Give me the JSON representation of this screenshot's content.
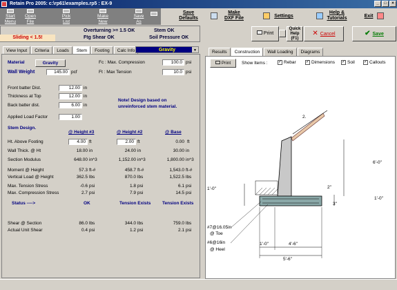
{
  "window": {
    "title": "Retain Pro 2005: c:\\rp61\\examples.rp5 : EX-9",
    "min": "_",
    "max": "□",
    "close": "×"
  },
  "toolbar1": [
    {
      "l1": "Start",
      "l2": "Menu"
    },
    {
      "l1": "Open",
      "l2": "File"
    },
    {
      "l1": "Pick",
      "l2": "List"
    },
    {
      "l1": "Make",
      "l2": "New"
    },
    {
      "l1": "Save",
      "l2": "As"
    },
    {
      "l1": "Print",
      "l2": ""
    }
  ],
  "toolbar2": {
    "save_defaults": [
      "Save",
      "Defaults"
    ],
    "make_dxf": [
      "Make",
      "DXF File"
    ],
    "settings": "Settings",
    "help": [
      "Help &",
      "Tutorials"
    ],
    "exit": "Exit"
  },
  "status": {
    "overturning": "Overturning >= 1.5 OK",
    "stem": "Stem OK",
    "sliding": "Sliding < 1.5!",
    "ftg_shear": "Ftg Shear OK",
    "soil_pressure": "Soil Pressure OK"
  },
  "actions": {
    "print": "Print",
    "quick_help": [
      "Quick",
      "Help",
      "(F1)"
    ],
    "cancel": "Cancel",
    "save": "Save"
  },
  "left_tabs": [
    "View Input",
    "Criteria",
    "Loads",
    "Stem",
    "Footing",
    "Calc Info"
  ],
  "material_select": "Gravity",
  "inputs": {
    "material_label": "Material",
    "material_btn": "Gravity",
    "wall_weight_label": "Wall Weight",
    "wall_weight": "145.00",
    "wall_weight_unit": "pcf",
    "fc_label": "Fc : Max. Compression",
    "fc": "100.0",
    "fc_unit": "psi",
    "ft_label": "Ft : Max Tension",
    "ft": "10.0",
    "ft_unit": "psi",
    "front_batter_label": "Front batter Dist.",
    "front_batter": "12.00",
    "thickness_label": "Thickness at Top",
    "thickness": "12.00",
    "back_batter_label": "Back batter dist.",
    "back_batter": "6.00",
    "unit_in": "in",
    "load_factor_label": "Applied Load Factor",
    "load_factor": "1.00",
    "note": "Note! Design based on unreinforced stem material."
  },
  "stem_design": {
    "title": "Stem Design.",
    "headers": [
      "@ Height #3",
      "@ Height #2",
      "@ Base"
    ],
    "ht_label": "Ht. Above Footing",
    "ht": [
      "4.00",
      "2.00",
      "0.00"
    ],
    "ht_unit": "ft",
    "rows": [
      {
        "label": "Wall Thick. @ Ht",
        "vals": [
          "18.00",
          "24.00",
          "30.00"
        ],
        "unit": "in"
      },
      {
        "label": "Section Modulus",
        "vals": [
          "648.00",
          "1,152.00",
          "1,800.00"
        ],
        "unit": "in^3"
      },
      {
        "label": "Moment @ Height",
        "vals": [
          "57.3",
          "458.7",
          "1,543.0"
        ],
        "unit": "ft-#"
      },
      {
        "label": "Vertical Load @ Height",
        "vals": [
          "362.5",
          "870.0",
          "1,522.5"
        ],
        "unit": "lbs"
      },
      {
        "label": "Max. Tension Stress",
        "vals": [
          "-0.6",
          "1.8",
          "6.1"
        ],
        "unit": "psi"
      },
      {
        "label": "Max. Compression Stress",
        "vals": [
          "2.7",
          "7.9",
          "14.5"
        ],
        "unit": "psi"
      }
    ],
    "status_label": "Status ---->",
    "status_vals": [
      "OK",
      "Tension Exists",
      "Tension Exists"
    ],
    "rows2": [
      {
        "label": "Shear @ Section",
        "vals": [
          "86.0",
          "344.0",
          "759.0"
        ],
        "unit": "lbs"
      },
      {
        "label": "Actual Unit Shear",
        "vals": [
          "0.4",
          "1.2",
          "2.1"
        ],
        "unit": "psi"
      }
    ]
  },
  "right_tabs": [
    "Results",
    "Construction",
    "Wall Loading",
    "Diagrams"
  ],
  "right_print": "Print",
  "show_items_label": "Show Items :",
  "show_items": [
    {
      "label": "Rebar",
      "checked": "✓"
    },
    {
      "label": "Dimensions",
      "checked": "✓"
    },
    {
      "label": "Soil",
      "checked": "✓"
    },
    {
      "label": "Callouts",
      "checked": "✓"
    }
  ],
  "drawing": {
    "dims": {
      "top": "2.",
      "right_height": "6'-0\"",
      "left_1": "1'-0\"",
      "right_2in": "2\"",
      "right_1ft": "1'-0\"",
      "right_3in": "3\"",
      "bot_1": "1'-0\"",
      "bot_2": "4'-6\"",
      "bot_total": "5'-6\""
    },
    "callout_toe": [
      "#7@16.05in",
      "@ Toe"
    ],
    "callout_heel": [
      "#6@16in",
      "@ Heel"
    ]
  },
  "colors": {
    "title_bar": "#0a246a",
    "status_red": "#cc0000",
    "save_green": "#007a00",
    "cancel_red": "#cc0000",
    "footing": "#8aa8a8",
    "wall": "#c8c8c8"
  }
}
